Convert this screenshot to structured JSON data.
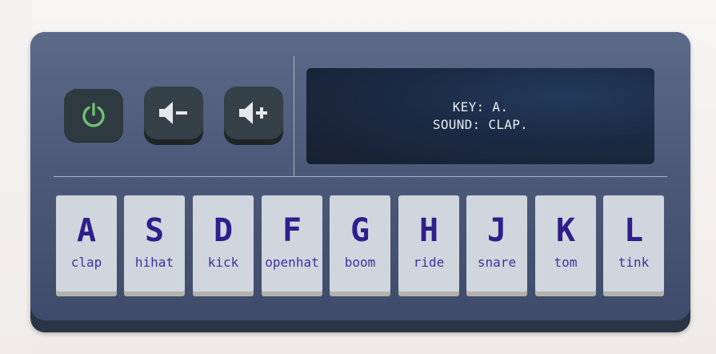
{
  "display": {
    "key_line": "KEY: A.",
    "sound_line": "SOUND: CLAP."
  },
  "controls": {
    "power": {
      "icon": "power-icon",
      "color": "#6fbf73"
    },
    "volume_down": {
      "icon": "volume-down-icon"
    },
    "volume_up": {
      "icon": "volume-up-icon"
    }
  },
  "pads": [
    {
      "key": "A",
      "sound": "clap"
    },
    {
      "key": "S",
      "sound": "hihat"
    },
    {
      "key": "D",
      "sound": "kick"
    },
    {
      "key": "F",
      "sound": "openhat"
    },
    {
      "key": "G",
      "sound": "boom"
    },
    {
      "key": "H",
      "sound": "ride"
    },
    {
      "key": "J",
      "sound": "snare"
    },
    {
      "key": "K",
      "sound": "tom"
    },
    {
      "key": "L",
      "sound": "tink"
    }
  ],
  "colors": {
    "key_text": "#301e8c",
    "pad_bg": "#d0d6dd",
    "device_body": "#4d5a7a",
    "screen_bg": "#1b2a44"
  }
}
